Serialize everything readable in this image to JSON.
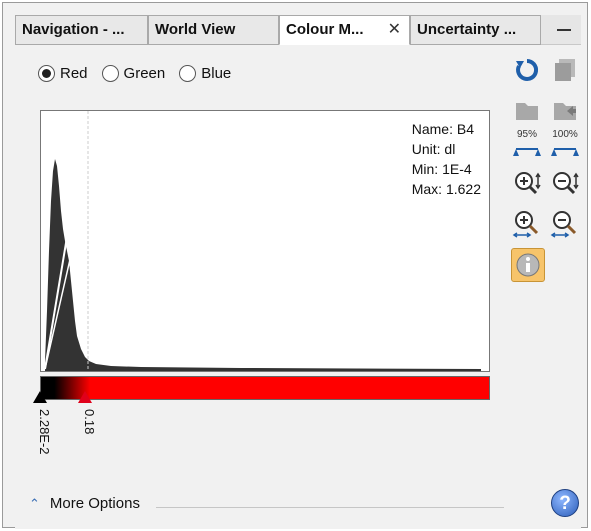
{
  "tabs": [
    {
      "label": "Navigation - ...",
      "active": false,
      "closable": false
    },
    {
      "label": "World View",
      "active": false,
      "closable": false
    },
    {
      "label": "Colour M...",
      "active": true,
      "closable": true,
      "close_glyph": "✕"
    },
    {
      "label": "Uncertainty ...",
      "active": false,
      "closable": false
    }
  ],
  "channels": {
    "options": [
      "Red",
      "Green",
      "Blue"
    ],
    "selected": "Red"
  },
  "band_info": {
    "name": "Name: B4",
    "unit": "Unit: dl",
    "min": "Min: 1E-4",
    "max": "Max: 1.622"
  },
  "sliders": [
    {
      "label": "2.28E-2",
      "colour": "#000000"
    },
    {
      "label": "0.18",
      "colour": "#e0001a"
    }
  ],
  "colour_bar": {
    "start": "#000000",
    "end": "#ff0000"
  },
  "toolbar": {
    "reset_icon": "reset-icon",
    "copy_icon": "copy-icon",
    "import_icon": "import-icon",
    "export_icon": "export-icon",
    "range_95_label": "95%",
    "range_100_label": "100%",
    "zoom_vertical_in_icon": "zoom-in-vertical-icon",
    "zoom_vertical_out_icon": "zoom-out-vertical-icon",
    "zoom_horizontal_in_icon": "zoom-in-horizontal-icon",
    "zoom_horizontal_out_icon": "zoom-out-horizontal-icon",
    "info_icon": "info-icon",
    "accent": "#f7c46a"
  },
  "footer": {
    "more_options_label": "More Options",
    "help_label": "?"
  }
}
